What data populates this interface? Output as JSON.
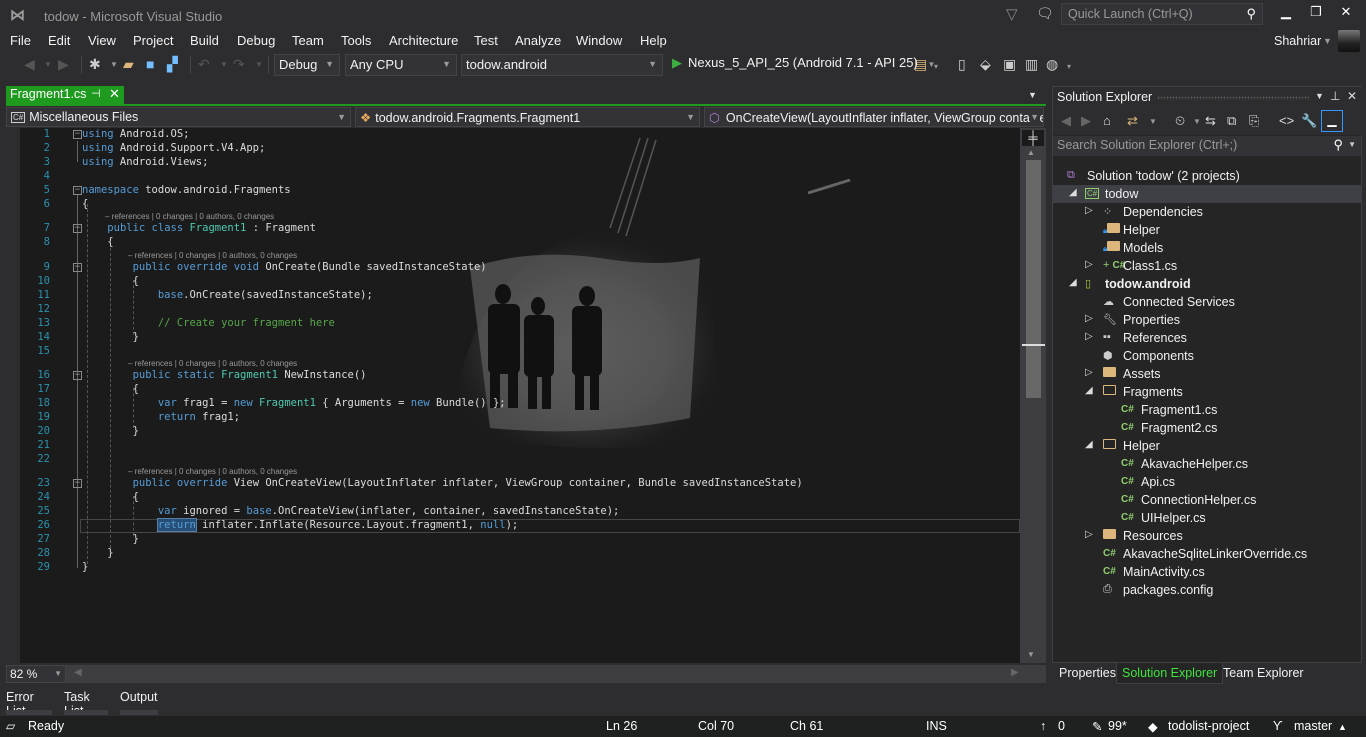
{
  "window": {
    "title": "todow - Microsoft Visual Studio",
    "quick_launch_placeholder": "Quick Launch (Ctrl+Q)",
    "controls": {
      "minimize": "▁",
      "restore": "❐",
      "close": "✕"
    }
  },
  "menu": [
    "File",
    "Edit",
    "View",
    "Project",
    "Build",
    "Debug",
    "Team",
    "Tools",
    "Architecture",
    "Test",
    "Analyze",
    "Window",
    "Help"
  ],
  "user": {
    "name": "Shahriar"
  },
  "toolbar": {
    "configuration": "Debug",
    "platform": "Any CPU",
    "startup_project": "todow.android",
    "run_target": "Nexus_5_API_25 (Android 7.1 - API 25)"
  },
  "document_tab": {
    "label": "Fragment1.cs",
    "pin": "⊣",
    "close": "✕"
  },
  "navigation": {
    "project": "Miscellaneous Files",
    "type": "todow.android.Fragments.Fragment1",
    "member": "OnCreateView(LayoutInflater inflater, ViewGroup container, Bundle savedInstanceState)"
  },
  "code_lens_text": "– references | 0 changes | 0 authors, 0 changes",
  "code": {
    "line_numbers": [
      "1",
      "2",
      "3",
      "4",
      "5",
      "6",
      "7",
      "8",
      "9",
      "10",
      "11",
      "12",
      "13",
      "14",
      "15",
      "16",
      "17",
      "18",
      "19",
      "20",
      "21",
      "22",
      "23",
      "24",
      "25",
      "26",
      "27",
      "28",
      "29"
    ],
    "current_line": 26
  },
  "zoom_level": "82 %",
  "tool_tabs": [
    "Error List",
    "Task List",
    "Output"
  ],
  "status": {
    "state": "Ready",
    "line": "Ln 26",
    "column": "Col 70",
    "char": "Ch 61",
    "mode": "INS",
    "unpushed": "0",
    "changes": "99*",
    "repo": "todolist-project",
    "branch": "master"
  },
  "solution_explorer": {
    "title": "Solution Explorer",
    "search_placeholder": "Search Solution Explorer (Ctrl+;)",
    "tree": [
      {
        "label": "Solution 'todow' (2 projects)",
        "icon": "solution-icon",
        "level": 0,
        "expander": ""
      },
      {
        "label": "todow",
        "icon": "csharp-project-icon",
        "level": 1,
        "expander": "expanded",
        "selected": true
      },
      {
        "label": "Dependencies",
        "icon": "dependencies-icon",
        "level": 2,
        "expander": "collapsed"
      },
      {
        "label": "Helper",
        "icon": "locked-folder-icon",
        "level": 2,
        "expander": ""
      },
      {
        "label": "Models",
        "icon": "locked-folder-icon",
        "level": 2,
        "expander": ""
      },
      {
        "label": "Class1.cs",
        "icon": "added-csharp-file-icon",
        "level": 2,
        "expander": "collapsed"
      },
      {
        "label": "todow.android",
        "icon": "android-project-icon",
        "level": 1,
        "expander": "expanded",
        "bold": true
      },
      {
        "label": "Connected Services",
        "icon": "connected-services-icon",
        "level": 2,
        "expander": ""
      },
      {
        "label": "Properties",
        "icon": "wrench-icon",
        "level": 2,
        "expander": "collapsed"
      },
      {
        "label": "References",
        "icon": "references-icon",
        "level": 2,
        "expander": "collapsed"
      },
      {
        "label": "Components",
        "icon": "components-icon",
        "level": 2,
        "expander": ""
      },
      {
        "label": "Assets",
        "icon": "folder-icon",
        "level": 2,
        "expander": "collapsed"
      },
      {
        "label": "Fragments",
        "icon": "open-folder-icon",
        "level": 2,
        "expander": "expanded"
      },
      {
        "label": "Fragment1.cs",
        "icon": "csharp-file-icon",
        "level": 3,
        "expander": ""
      },
      {
        "label": "Fragment2.cs",
        "icon": "csharp-file-icon",
        "level": 3,
        "expander": ""
      },
      {
        "label": "Helper",
        "icon": "open-folder-icon",
        "level": 2,
        "expander": "expanded"
      },
      {
        "label": "AkavacheHelper.cs",
        "icon": "csharp-file-icon",
        "level": 3,
        "expander": ""
      },
      {
        "label": "Api.cs",
        "icon": "csharp-file-icon",
        "level": 3,
        "expander": ""
      },
      {
        "label": "ConnectionHelper.cs",
        "icon": "csharp-file-icon",
        "level": 3,
        "expander": ""
      },
      {
        "label": "UIHelper.cs",
        "icon": "csharp-file-icon",
        "level": 3,
        "expander": ""
      },
      {
        "label": "Resources",
        "icon": "folder-icon",
        "level": 2,
        "expander": "collapsed"
      },
      {
        "label": "AkavacheSqliteLinkerOverride.cs",
        "icon": "csharp-file-icon",
        "level": 2,
        "expander": ""
      },
      {
        "label": "MainActivity.cs",
        "icon": "csharp-file-icon",
        "level": 2,
        "expander": ""
      },
      {
        "label": "packages.config",
        "icon": "config-file-icon",
        "level": 2,
        "expander": ""
      }
    ],
    "bottom_tabs": [
      "Properties",
      "Solution Explorer",
      "Team Explorer"
    ],
    "active_bottom_tab": "Solution Explorer"
  },
  "colors": {
    "accent_green": "#1e9b1e",
    "keyword": "#569cd6",
    "type": "#4ec9b0",
    "comment": "#57a64a",
    "line_number": "#2b91af",
    "active_tab_text": "#3fe43f"
  }
}
